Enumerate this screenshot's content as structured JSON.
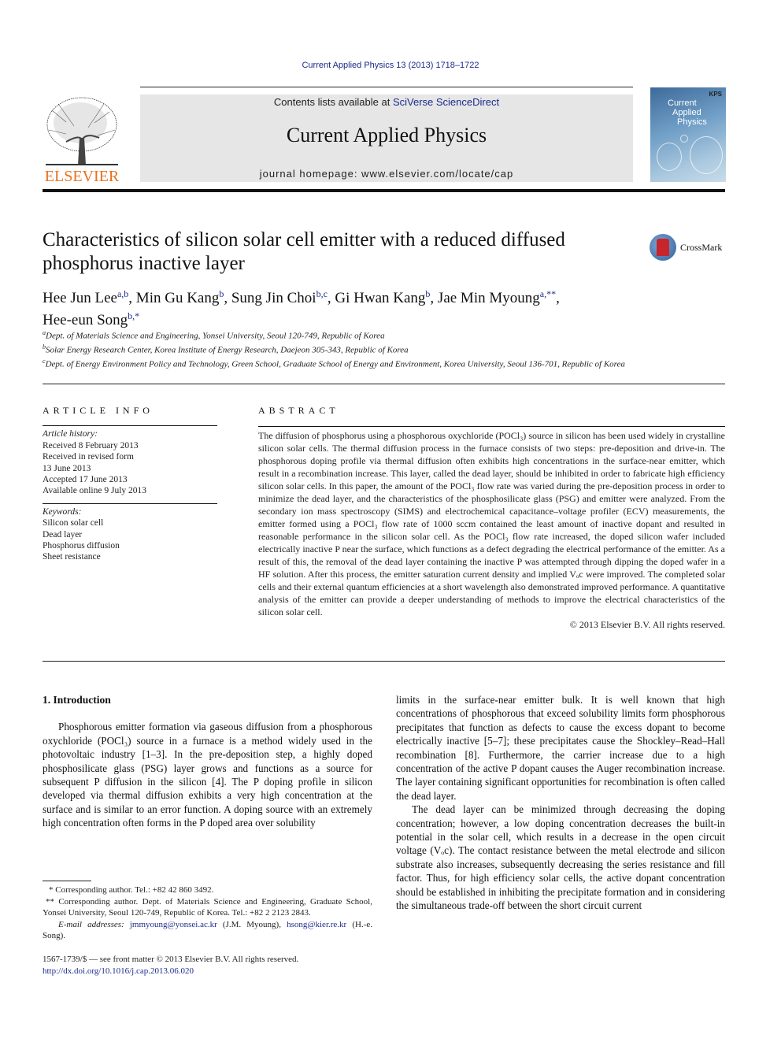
{
  "journal_citation": "Current Applied Physics 13 (2013) 1718–1722",
  "header": {
    "publisher_logo_text": "ELSEVIER",
    "contents_prefix": "Contents lists available at ",
    "contents_link": "SciVerse ScienceDirect",
    "journal_title": "Current Applied Physics",
    "homepage": "journal homepage: www.elsevier.com/locate/cap",
    "cover": {
      "title_lines": [
        "Current",
        "Applied",
        "Physics"
      ],
      "publisher_mark": "KPS"
    }
  },
  "article": {
    "title": "Characteristics of silicon solar cell emitter with a reduced diffused phosphorus inactive layer",
    "crossmark_label": "CrossMark",
    "authors": [
      {
        "name": "Hee Jun Lee",
        "sup": "a,b",
        "sep": ", "
      },
      {
        "name": "Min Gu Kang",
        "sup": "b",
        "sep": ", "
      },
      {
        "name": "Sung Jin Choi",
        "sup": "b,c",
        "sep": ", "
      },
      {
        "name": "Gi Hwan Kang",
        "sup": "b",
        "sep": ", "
      },
      {
        "name": "Jae Min Myoung",
        "sup": "a,**",
        "sep": ","
      },
      {
        "name": "Hee-eun Song",
        "sup": "b,*",
        "sep": ""
      }
    ],
    "affiliations": [
      {
        "key": "a",
        "text": "Dept. of Materials Science and Engineering, Yonsei University, Seoul 120-749, Republic of Korea"
      },
      {
        "key": "b",
        "text": "Solar Energy Research Center, Korea Institute of Energy Research, Daejeon 305-343, Republic of Korea"
      },
      {
        "key": "c",
        "text": "Dept. of Energy Environment Policy and Technology, Green School, Graduate School of Energy and Environment, Korea University, Seoul 136-701, Republic of Korea"
      }
    ]
  },
  "article_info": {
    "heading": "ARTICLE INFO",
    "history_label": "Article history:",
    "history": [
      "Received 8 February 2013",
      "Received in revised form",
      "13 June 2013",
      "Accepted 17 June 2013",
      "Available online 9 July 2013"
    ],
    "keywords_label": "Keywords:",
    "keywords": [
      "Silicon solar cell",
      "Dead layer",
      "Phosphorus diffusion",
      "Sheet resistance"
    ]
  },
  "abstract": {
    "heading": "ABSTRACT",
    "text": "The diffusion of phosphorus using a phosphorous oxychloride (POCl₃) source in silicon has been used widely in crystalline silicon solar cells. The thermal diffusion process in the furnace consists of two steps: pre-deposition and drive-in. The phosphorous doping profile via thermal diffusion often exhibits high concentrations in the surface-near emitter, which result in a recombination increase. This layer, called the dead layer, should be inhibited in order to fabricate high efficiency silicon solar cells. In this paper, the amount of the POCl₃ flow rate was varied during the pre-deposition process in order to minimize the dead layer, and the characteristics of the phosphosilicate glass (PSG) and emitter were analyzed. From the secondary ion mass spectroscopy (SIMS) and electrochemical capacitance–voltage profiler (ECV) measurements, the emitter formed using a POCl₃ flow rate of 1000 sccm contained the least amount of inactive dopant and resulted in reasonable performance in the silicon solar cell. As the POCl₃ flow rate increased, the doped silicon wafer included electrically inactive P near the surface, which functions as a defect degrading the electrical performance of the emitter. As a result of this, the removal of the dead layer containing the inactive P was attempted through dipping the doped wafer in a HF solution. After this process, the emitter saturation current density and implied Vₒc were improved. The completed solar cells and their external quantum efficiencies at a short wavelength also demonstrated improved performance. A quantitative analysis of the emitter can provide a deeper understanding of methods to improve the electrical characteristics of the silicon solar cell.",
    "copyright": "© 2013 Elsevier B.V. All rights reserved."
  },
  "body": {
    "section_heading": "1.  Introduction",
    "col1_para1": "Phosphorous emitter formation via gaseous diffusion from a phosphorous oxychloride (POCl₃) source in a furnace is a method widely used in the photovoltaic industry [1–3]. In the pre-deposition step, a highly doped phosphosilicate glass (PSG) layer grows and functions as a source for subsequent P diffusion in the silicon [4]. The P doping profile in silicon developed via thermal diffusion exhibits a very high concentration at the surface and is similar to an error function. A doping source with an extremely high concentration often forms in the P doped area over solubility",
    "col2_para1": "limits in the surface-near emitter bulk. It is well known that high concentrations of phosphorous that exceed solubility limits form phosphorous precipitates that function as defects to cause the excess dopant to become electrically inactive [5–7]; these precipitates cause the Shockley–Read–Hall recombination [8]. Furthermore, the carrier increase due to a high concentration of the active P dopant causes the Auger recombination increase. The layer containing significant opportunities for recombination is often called the dead layer.",
    "col2_para2": "The dead layer can be minimized through decreasing the doping concentration; however, a low doping concentration decreases the built-in potential in the solar cell, which results in a decrease in the open circuit voltage (Vₒc). The contact resistance between the metal electrode and silicon substrate also increases, subsequently decreasing the series resistance and fill factor. Thus, for high efficiency solar cells, the active dopant concentration should be established in inhibiting the precipitate formation and in considering the simultaneous trade-off between the short circuit current"
  },
  "footnotes": {
    "note1": "* Corresponding author. Tel.: +82 42 860 3492.",
    "note2": "** Corresponding author. Dept. of Materials Science and Engineering, Graduate School, Yonsei University, Seoul 120-749, Republic of Korea. Tel.: +82 2 2123 2843.",
    "email_label": "E-mail addresses:",
    "email1": "jmmyoung@yonsei.ac.kr",
    "email1_owner": "(J.M. Myoung),",
    "email2": "hsong@kier.re.kr",
    "email2_owner": "(H.-e. Song)."
  },
  "front_matter": {
    "issn_line": "1567-1739/$ — see front matter © 2013 Elsevier B.V. All rights reserved.",
    "doi": "http://dx.doi.org/10.1016/j.cap.2013.06.020"
  },
  "colors": {
    "link": "#1c2a8c",
    "banner_bg": "#e6e6e6",
    "elsevier_orange": "#e9711c"
  }
}
